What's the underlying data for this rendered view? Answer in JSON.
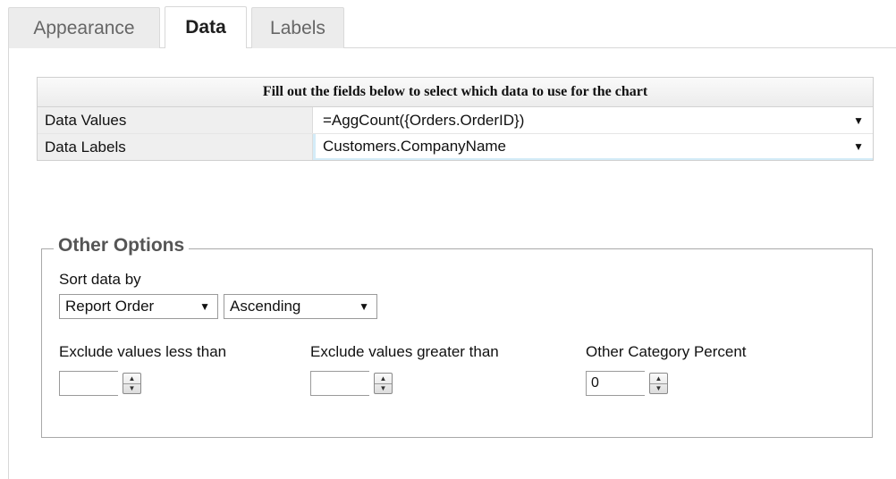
{
  "tabs": [
    {
      "label": "Appearance",
      "active": false
    },
    {
      "label": "Data",
      "active": true
    },
    {
      "label": "Labels",
      "active": false
    }
  ],
  "grid": {
    "header": "Fill out the fields below to select which data to use for the chart",
    "rows": [
      {
        "label": "Data Values",
        "value": "=AggCount({Orders.OrderID})"
      },
      {
        "label": "Data Labels",
        "value": "Customers.CompanyName"
      }
    ],
    "dropdown_icon": "▼"
  },
  "options": {
    "legend": "Other Options",
    "sort_label": "Sort data by",
    "sort_field": {
      "selected": "Report Order"
    },
    "sort_direction": {
      "selected": "Ascending"
    },
    "exclude_less_label": "Exclude values less than",
    "exclude_less_value": "",
    "exclude_greater_label": "Exclude values greater than",
    "exclude_greater_value": "",
    "other_percent_label": "Other Category Percent",
    "other_percent_value": "0"
  },
  "colors": {
    "active_tab_bg": "#ffffff",
    "inactive_tab_bg": "#ececec",
    "grid_label_bg": "#efefef",
    "focus_highlight": "#d4ecf8"
  }
}
